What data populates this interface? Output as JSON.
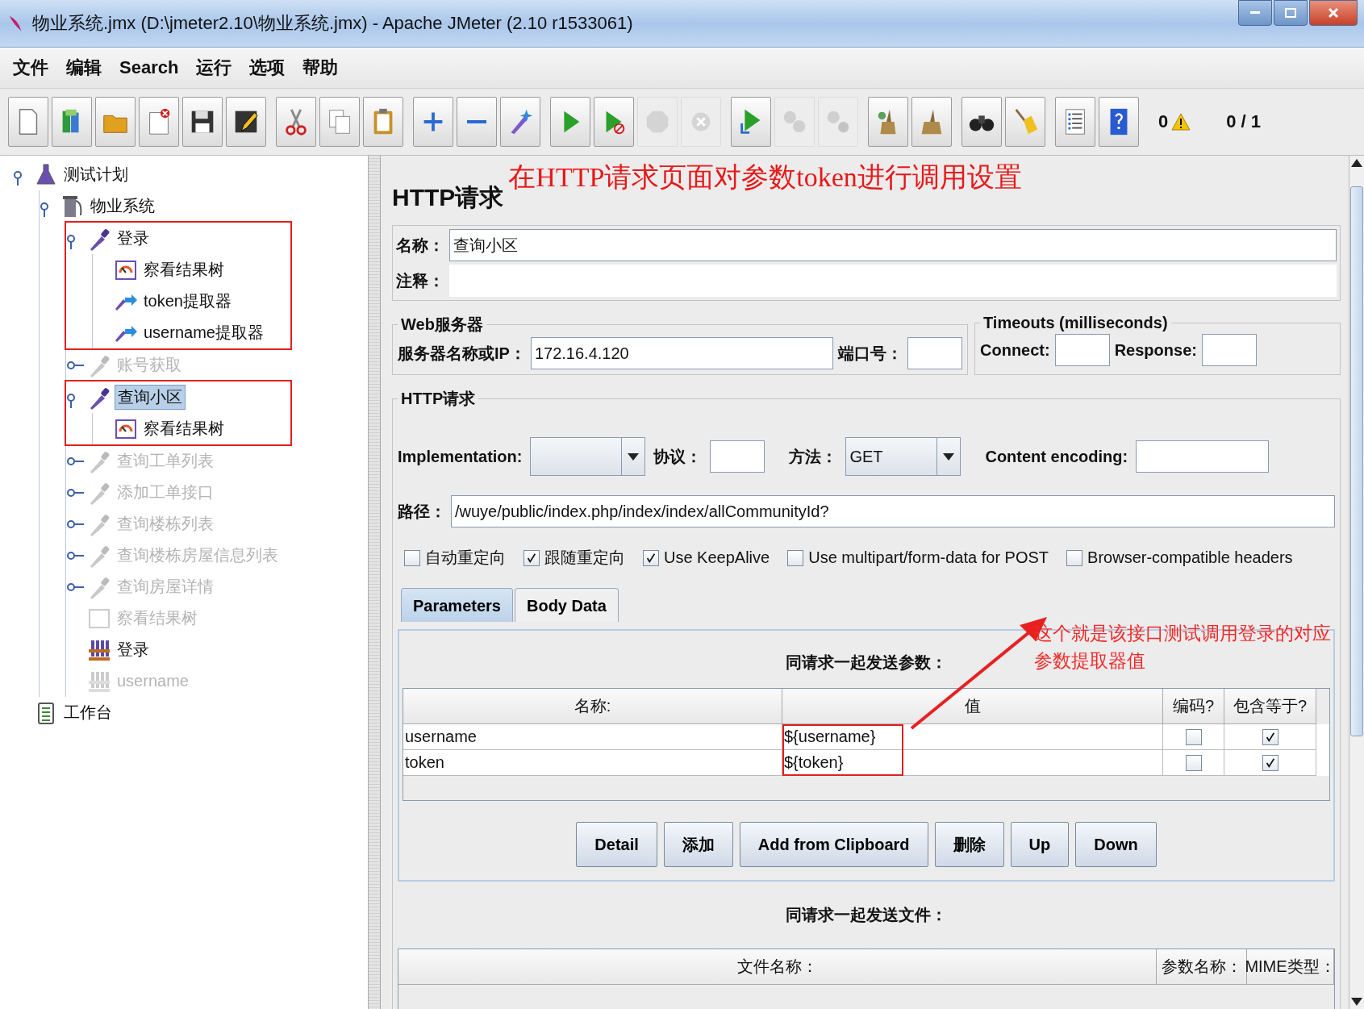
{
  "window": {
    "title": "物业系统.jmx (D:\\jmeter2.10\\物业系统.jmx) - Apache JMeter (2.10 r1533061)"
  },
  "menu": [
    "文件",
    "编辑",
    "Search",
    "运行",
    "选项",
    "帮助"
  ],
  "toolbar": {
    "groups": [
      [
        {
          "kind": "new",
          "disabled": false
        },
        {
          "kind": "templates",
          "disabled": false
        },
        {
          "kind": "open",
          "disabled": false
        },
        {
          "kind": "close",
          "disabled": false
        },
        {
          "kind": "save",
          "disabled": false
        },
        {
          "kind": "save-as",
          "disabled": false
        }
      ],
      [
        {
          "kind": "cut",
          "disabled": false
        },
        {
          "kind": "copy",
          "disabled": false
        },
        {
          "kind": "paste",
          "disabled": false
        }
      ],
      [
        {
          "kind": "expand",
          "disabled": false
        },
        {
          "kind": "collapse",
          "disabled": false
        },
        {
          "kind": "toggle",
          "disabled": false
        }
      ],
      [
        {
          "kind": "start",
          "disabled": false
        },
        {
          "kind": "start-no-pause",
          "disabled": false
        },
        {
          "kind": "stop",
          "disabled": true
        },
        {
          "kind": "shutdown",
          "disabled": true
        }
      ],
      [
        {
          "kind": "remote-start",
          "disabled": false
        },
        {
          "kind": "remote-stop",
          "disabled": true
        },
        {
          "kind": "remote-shutdown",
          "disabled": true
        }
      ],
      [
        {
          "kind": "clear",
          "disabled": false
        },
        {
          "kind": "clear-all",
          "disabled": false
        }
      ],
      [
        {
          "kind": "search",
          "disabled": false
        },
        {
          "kind": "reset-search",
          "disabled": false
        }
      ],
      [
        {
          "kind": "function-helper",
          "disabled": false
        },
        {
          "kind": "help",
          "disabled": false
        }
      ]
    ],
    "warnings": "0",
    "threads": "0 / 1"
  },
  "tree": [
    {
      "label": "测试计划",
      "kind": "plan",
      "selected": false,
      "disabled": false,
      "expanded": true,
      "children": [
        {
          "label": "物业系统",
          "kind": "thread-group",
          "selected": false,
          "disabled": false,
          "expanded": true,
          "children": [
            {
              "label": "登录",
              "kind": "sampler",
              "selected": false,
              "disabled": false,
              "expanded": true,
              "boxed": true,
              "children": [
                {
                  "label": "察看结果树",
                  "kind": "listener",
                  "selected": false,
                  "disabled": false
                },
                {
                  "label": "token提取器",
                  "kind": "extractor",
                  "selected": false,
                  "disabled": false
                },
                {
                  "label": "username提取器",
                  "kind": "extractor",
                  "selected": false,
                  "disabled": false
                }
              ]
            },
            {
              "label": "账号获取",
              "kind": "sampler",
              "selected": false,
              "disabled": true,
              "expanded": false
            },
            {
              "label": "查询小区",
              "kind": "sampler",
              "selected": true,
              "disabled": false,
              "expanded": true,
              "boxed": true,
              "children": [
                {
                  "label": "察看结果树",
                  "kind": "listener",
                  "selected": false,
                  "disabled": false
                }
              ]
            },
            {
              "label": "查询工单列表",
              "kind": "sampler",
              "selected": false,
              "disabled": true,
              "expanded": false
            },
            {
              "label": "添加工单接口",
              "kind": "sampler",
              "selected": false,
              "disabled": true,
              "expanded": false
            },
            {
              "label": "查询楼栋列表",
              "kind": "sampler",
              "selected": false,
              "disabled": true,
              "expanded": false
            },
            {
              "label": "查询楼栋房屋信息列表",
              "kind": "sampler",
              "selected": false,
              "disabled": true,
              "expanded": false
            },
            {
              "label": "查询房屋详情",
              "kind": "sampler",
              "selected": false,
              "disabled": true,
              "expanded": false
            },
            {
              "label": "察看结果树",
              "kind": "listener",
              "selected": false,
              "disabled": true
            },
            {
              "label": "登录",
              "kind": "rack",
              "selected": false,
              "disabled": false
            },
            {
              "label": "username",
              "kind": "rack",
              "selected": false,
              "disabled": true
            }
          ]
        }
      ]
    },
    {
      "label": "工作台",
      "kind": "workbench",
      "selected": false,
      "disabled": false
    }
  ],
  "panel": {
    "title": "HTTP请求",
    "note": "在HTTP请求页面对参数token进行调用设置",
    "name_label": "名称：",
    "name_value": "查询小区",
    "comment_label": "注释：",
    "web_server": {
      "legend": "Web服务器",
      "server_label": "服务器名称或IP：",
      "server_value": "172.16.4.120",
      "port_label": "端口号："
    },
    "timeouts": {
      "legend": "Timeouts (milliseconds)",
      "connect_label": "Connect:",
      "response_label": "Response:"
    },
    "http": {
      "legend": "HTTP请求",
      "implementation_label": "Implementation:",
      "protocol_label": "协议：",
      "method_label": "方法：",
      "method_value": "GET",
      "encoding_label": "Content encoding:",
      "path_label": "路径：",
      "path_value": "/wuye/public/index.php/index/index/allCommunityId?",
      "options": [
        {
          "label": "自动重定向",
          "checked": false
        },
        {
          "label": "跟随重定向",
          "checked": true
        },
        {
          "label": "Use KeepAlive",
          "checked": true
        },
        {
          "label": "Use multipart/form-data for POST",
          "checked": false
        },
        {
          "label": "Browser-compatible headers",
          "checked": false
        }
      ]
    },
    "tabs": [
      {
        "label": "Parameters",
        "selected": true
      },
      {
        "label": "Body Data",
        "selected": false
      }
    ],
    "params": {
      "title": "同请求一起发送参数：",
      "columns": [
        {
          "label": "名称:"
        },
        {
          "label": "值",
          "boxed": true
        },
        {
          "label": "编码?"
        },
        {
          "label": "包含等于?"
        }
      ],
      "rows": [
        {
          "name": "username",
          "value": "${username}",
          "encode": false,
          "include_equals": true
        },
        {
          "name": "token",
          "value": "${token}",
          "encode": false,
          "include_equals": true
        }
      ]
    },
    "buttons": [
      "Detail",
      "添加",
      "Add from Clipboard",
      "删除",
      "Up",
      "Down"
    ],
    "files": {
      "title": "同请求一起发送文件：",
      "columns": [
        "文件名称：",
        "参数名称：",
        "MIME类型："
      ]
    },
    "callout": {
      "lines": [
        "这个就是该接口测试调用登录的对应",
        "参数提取器值"
      ]
    }
  }
}
